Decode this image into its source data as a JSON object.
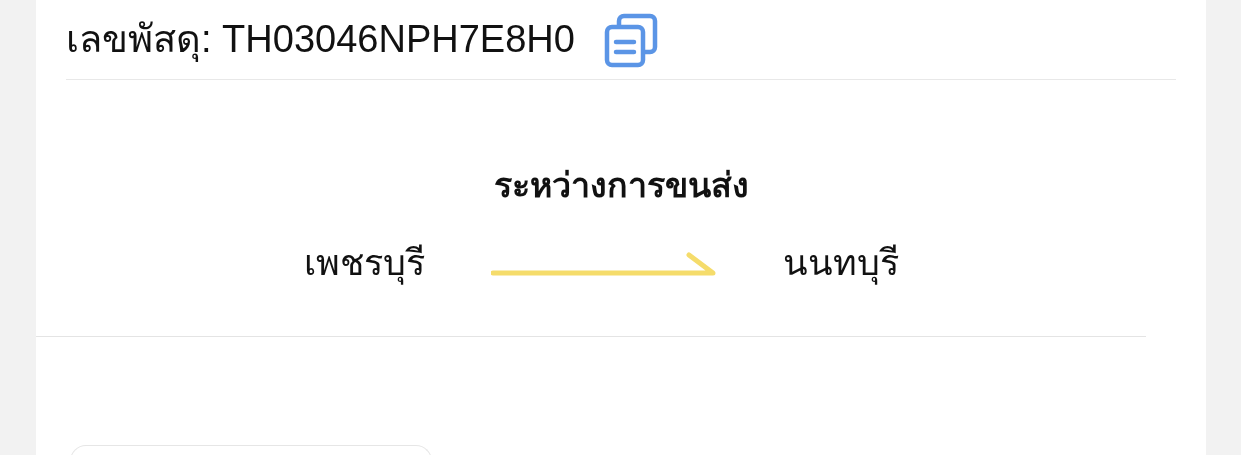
{
  "parcel": {
    "label": "เลขพัสดุ:",
    "number": "TH03046NPH7E8H0"
  },
  "shipment": {
    "status": "ระหว่างการขนส่ง",
    "origin": "เพชรบุรี",
    "destination": "นนทบุรี"
  }
}
